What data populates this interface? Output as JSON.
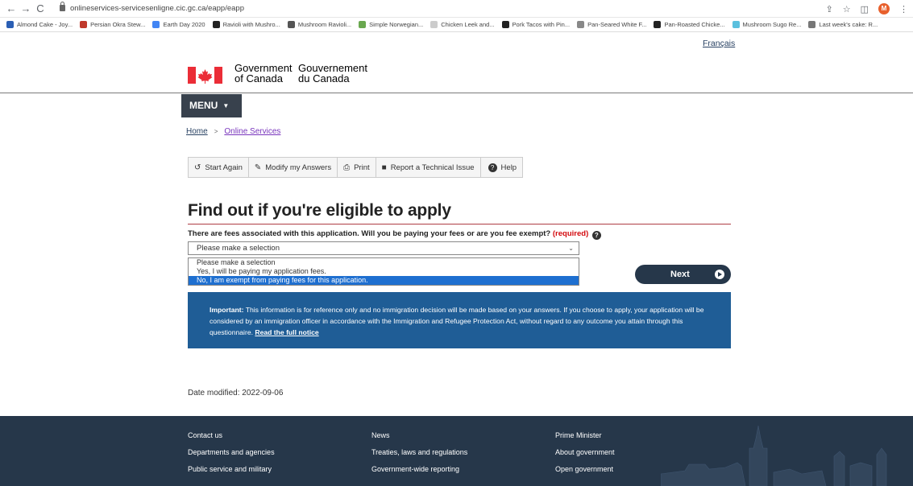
{
  "browser": {
    "url": "onlineservices-servicesenligne.cic.gc.ca/eapp/eapp",
    "avatar_letter": "M",
    "bookmarks": [
      {
        "label": "Almond Cake - Joy...",
        "color": "#2b5fb4"
      },
      {
        "label": "Persian Okra Stew...",
        "color": "#c0392b"
      },
      {
        "label": "Earth Day 2020",
        "color": "#4285f4"
      },
      {
        "label": "Ravioli with Mushro...",
        "color": "#222222"
      },
      {
        "label": "Mushroom Ravioli...",
        "color": "#555555"
      },
      {
        "label": "Simple Norwegian...",
        "color": "#6aa84f"
      },
      {
        "label": "Chicken Leek and...",
        "color": "#cccccc"
      },
      {
        "label": "Pork Tacos with Pin...",
        "color": "#222222"
      },
      {
        "label": "Pan-Seared White F...",
        "color": "#888888"
      },
      {
        "label": "Pan-Roasted Chicke...",
        "color": "#222222"
      },
      {
        "label": "Mushroom Sugo Re...",
        "color": "#5bc0de"
      },
      {
        "label": "Last week's cake: R...",
        "color": "#777777"
      }
    ]
  },
  "header": {
    "language_toggle": "Français",
    "gov_en_line1": "Government",
    "gov_en_line2": "of Canada",
    "gov_fr_line1": "Gouvernement",
    "gov_fr_line2": "du Canada"
  },
  "menu": {
    "label": "MENU"
  },
  "breadcrumb": {
    "home": "Home",
    "online_services": "Online Services"
  },
  "toolbar": {
    "start_again": "Start Again",
    "modify_answers": "Modify my Answers",
    "print": "Print",
    "report_issue": "Report a Technical Issue",
    "help": "Help"
  },
  "main": {
    "title": "Find out if you're eligible to apply",
    "question": "There are fees associated with this application. Will you be paying your fees or are you fee exempt?",
    "required": "(required)",
    "select_value": "Please make a selection",
    "options": [
      "Please make a selection",
      "Yes, I will be paying my application fees.",
      "No, I am exempt from paying fees for this application."
    ],
    "highlighted_option_index": 2,
    "next_label": "Next"
  },
  "notice": {
    "important_label": "Important:",
    "text": " This information is for reference only and no immigration decision will be made based on your answers. If you choose to apply, your application will be considered by an immigration officer in accordance with the Immigration and Refugee Protection Act, without regard to any outcome you attain through this questionnaire. ",
    "link": "Read the full notice"
  },
  "date_modified": "Date modified: 2022-09-06",
  "footer": {
    "col1": [
      "Contact us",
      "Departments and agencies",
      "Public service and military"
    ],
    "col2": [
      "News",
      "Treaties, laws and regulations",
      "Government-wide reporting"
    ],
    "col3": [
      "Prime Minister",
      "About government",
      "Open government"
    ]
  },
  "colors": {
    "gc_dark_blue": "#26374a",
    "notice_blue": "#1f5d96",
    "gc_red": "#af3c43",
    "select_highlight": "#1e6fd0"
  }
}
